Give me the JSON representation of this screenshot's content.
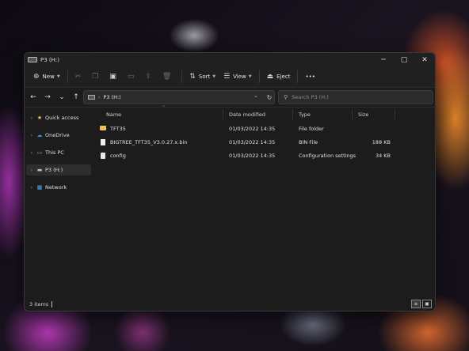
{
  "window": {
    "title": "P3 (H:)"
  },
  "window_controls": {
    "minimize": "─",
    "maximize": "▢",
    "close": "✕"
  },
  "toolbar": {
    "new_label": "New",
    "sort_label": "Sort",
    "view_label": "View",
    "eject_label": "Eject",
    "more_label": "•••"
  },
  "address": {
    "path": "P3 (H:)",
    "chevron": "›"
  },
  "search": {
    "placeholder": "Search P3 (H:)"
  },
  "sidebar": {
    "items": [
      {
        "label": "Quick access",
        "icon": "star-icon"
      },
      {
        "label": "OneDrive",
        "icon": "cloud-icon"
      },
      {
        "label": "This PC",
        "icon": "monitor-icon"
      },
      {
        "label": "P3 (H:)",
        "icon": "drive-icon",
        "selected": true
      },
      {
        "label": "Network",
        "icon": "network-icon"
      }
    ]
  },
  "columns": {
    "name": "Name",
    "date": "Date modified",
    "type": "Type",
    "size": "Size"
  },
  "files": [
    {
      "name": "TFT35",
      "date": "01/03/2022 14:35",
      "type": "File folder",
      "size": "",
      "icon": "folder-icon"
    },
    {
      "name": "BIGTREE_TFT35_V3.0.27.x.bin",
      "date": "01/03/2022 14:35",
      "type": "BIN File",
      "size": "188 KB",
      "icon": "file-icon"
    },
    {
      "name": "config",
      "date": "01/03/2022 14:35",
      "type": "Configuration settings",
      "size": "34 KB",
      "icon": "config-icon"
    }
  ],
  "status": {
    "count": "3 items"
  },
  "colors": {
    "folder": "#e8c15a",
    "window_bg": "#1c1c1c",
    "accent_star": "#f2c94c",
    "accent_cloud": "#3a8ee6"
  }
}
